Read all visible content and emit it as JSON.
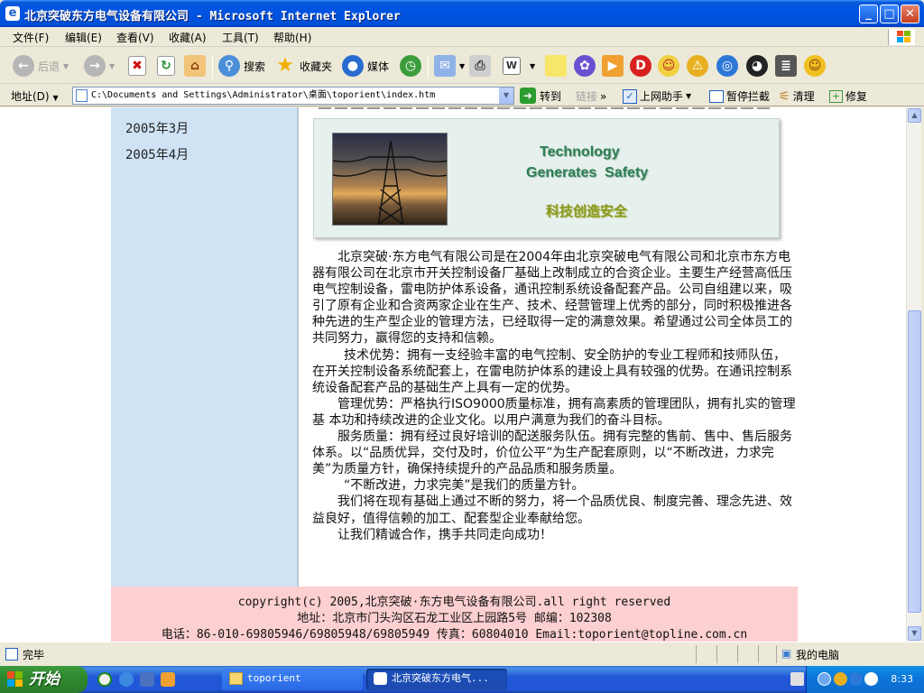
{
  "window": {
    "title": "北京突破东方电气设备有限公司 - Microsoft Internet Explorer",
    "minimize": "_",
    "maximize": "□",
    "close": "✕"
  },
  "menu": [
    "文件(F)",
    "编辑(E)",
    "查看(V)",
    "收藏(A)",
    "工具(T)",
    "帮助(H)"
  ],
  "toolbar": {
    "back": "后退",
    "search": "搜索",
    "favorites": "收藏夹",
    "media": "媒体"
  },
  "addressbar": {
    "label": "地址(D)",
    "url": "C:\\Documents and Settings\\Administrator\\桌面\\toporient\\index.htm",
    "go": "转到",
    "links": "链接",
    "helper": "上网助手",
    "popup_block": "暂停拦截",
    "clean": "清理",
    "repair": "修复"
  },
  "sidebar": {
    "months": [
      "2005年3月",
      "2005年4月"
    ]
  },
  "banner": {
    "line1": "Technology",
    "line2": "Generates  Safety",
    "line3": "科技创造安全"
  },
  "content": {
    "paragraphs": [
      "北京突破·东方电气有限公司是在2004年由北京突破电气有限公司和北京市东方电器有限公司在北京市开关控制设备厂基础上改制成立的合资企业。主要生产经营高低压电气控制设备，雷电防护体系设备，通讯控制系统设备配套产品。公司自组建以来，吸引了原有企业和合资两家企业在生产、技术、经营管理上优秀的部分，同时积极推进各种先进的生产型企业的管理方法，已经取得一定的满意效果。希望通过公司全体员工的共同努力，赢得您的支持和信赖。",
      "技术优势：拥有一支经验丰富的电气控制、安全防护的专业工程师和技师队伍，在开关控制设备系统配套上，在雷电防护体系的建设上具有较强的优势。在通讯控制系统设备配套产品的基础生产上具有一定的优势。",
      "管理优势：严格执行ISO9000质量标准，拥有高素质的管理团队，拥有扎实的管理基 本功和持续改进的企业文化。以用户满意为我们的奋斗目标。",
      "服务质量：拥有经过良好培训的配送服务队伍。拥有完整的售前、售中、售后服务体系。以“品质优异，交付及时，价位公平”为生产配套原则，以“不断改进，力求完美”为质量方针，确保持续提升的产品品质和服务质量。",
      "“不断改进，力求完美”是我们的质量方针。",
      "我们将在现有基础上通过不断的努力，将一个品质优良、制度完善、理念先进、效益良好，值得信赖的加工、配套型企业奉献给您。",
      "让我们精诚合作，携手共同走向成功！"
    ]
  },
  "footer": {
    "copyright": "copyright(c) 2005,北京突破·东方电气设备有限公司.all right reserved",
    "address": "地址：北京市门头沟区石龙工业区上园路5号  邮编：102308",
    "contact": "电话：86-010-69805946/69805948/69805949 传真：60804010 Email:toporient@topline.com.cn"
  },
  "status": {
    "text": "完毕",
    "zone": "我的电脑"
  },
  "taskbar": {
    "start": "开始",
    "tasks": [
      "toporient",
      "北京突破东方电气..."
    ],
    "clock": "8:33"
  }
}
